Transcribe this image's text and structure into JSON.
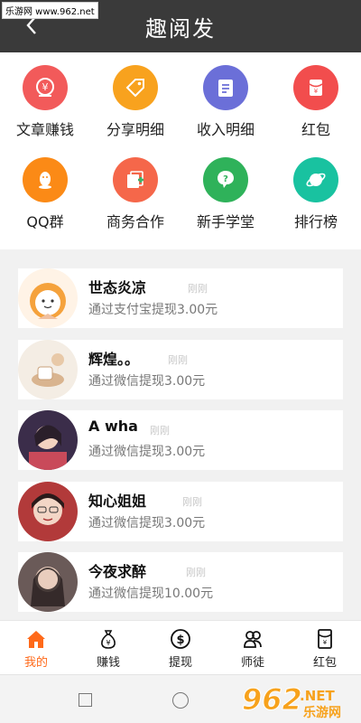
{
  "watermark": "乐游网 www.962.net",
  "header": {
    "title": "趣阅发",
    "back_icon": "‹"
  },
  "grid": [
    {
      "label": "文章赚钱",
      "icon": "money-icon",
      "color": "#f25a5a"
    },
    {
      "label": "分享明细",
      "icon": "tag-icon",
      "color": "#f8a21e"
    },
    {
      "label": "收入明细",
      "icon": "clipboard-icon",
      "color": "#6b6fd8"
    },
    {
      "label": "红包",
      "icon": "red-envelope-icon",
      "color": "#f24d4d"
    },
    {
      "label": "QQ群",
      "icon": "qq-icon",
      "color": "#fb8a16"
    },
    {
      "label": "商务合作",
      "icon": "business-icon",
      "color": "#f5674a"
    },
    {
      "label": "新手学堂",
      "icon": "question-icon",
      "color": "#2fb25a"
    },
    {
      "label": "排行榜",
      "icon": "planet-icon",
      "color": "#19c2a0"
    }
  ],
  "withdrawals": [
    {
      "name": "世态炎凉",
      "time": "刚刚",
      "desc": "通过支付宝提现3.00元"
    },
    {
      "name": "辉煌。。",
      "time": "刚刚",
      "desc": "通过微信提现3.00元"
    },
    {
      "name": "A wha",
      "time": "刚刚",
      "desc": "通过微信提现3.00元"
    },
    {
      "name": "知心姐姐",
      "time": "刚刚",
      "desc": "通过微信提现3.00元"
    },
    {
      "name": "今夜求醉",
      "time": "刚刚",
      "desc": "通过微信提现10.00元"
    }
  ],
  "tabs": [
    {
      "label": "我的",
      "icon": "home-icon",
      "active": true
    },
    {
      "label": "赚钱",
      "icon": "money-bag-icon",
      "active": false
    },
    {
      "label": "提现",
      "icon": "dollar-icon",
      "active": false
    },
    {
      "label": "师徒",
      "icon": "people-icon",
      "active": false
    },
    {
      "label": "红包",
      "icon": "red-envelope-icon",
      "active": false
    }
  ],
  "site_logo": {
    "big": "962",
    "suffix": ".NET",
    "sub": "乐游网"
  },
  "accent": "#ff6a1a"
}
